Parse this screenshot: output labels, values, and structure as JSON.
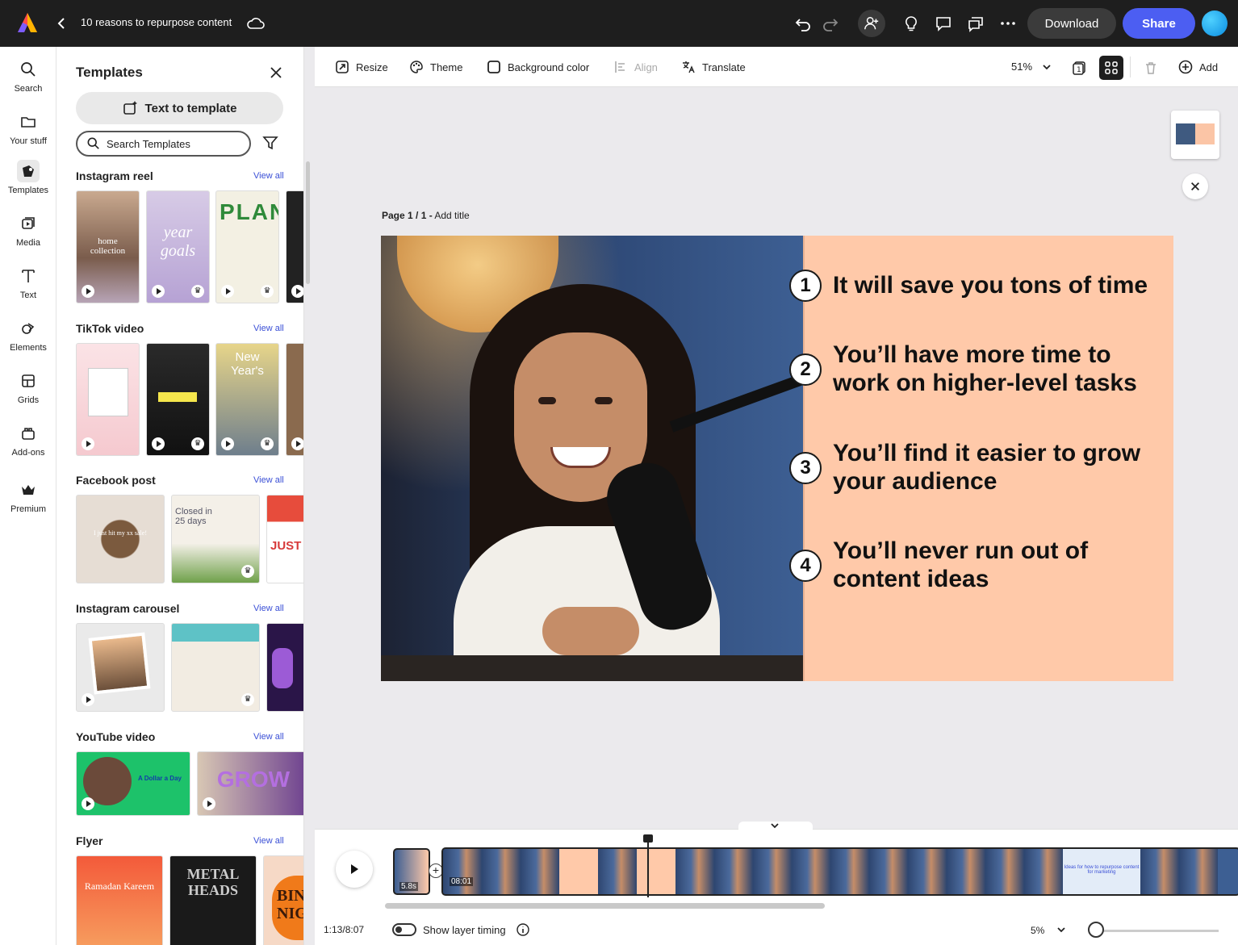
{
  "topbar": {
    "doc_title": "10 reasons to repurpose content",
    "download_label": "Download",
    "share_label": "Share"
  },
  "rail": {
    "items": [
      {
        "label": "Search",
        "icon": "search-icon"
      },
      {
        "label": "Your stuff",
        "icon": "folder-icon"
      },
      {
        "label": "Templates",
        "icon": "templates-icon"
      },
      {
        "label": "Media",
        "icon": "media-icon"
      },
      {
        "label": "Text",
        "icon": "text-icon"
      },
      {
        "label": "Elements",
        "icon": "elements-icon"
      },
      {
        "label": "Grids",
        "icon": "grids-icon"
      },
      {
        "label": "Add-ons",
        "icon": "addons-icon"
      },
      {
        "label": "Premium",
        "icon": "premium-crown-icon"
      }
    ]
  },
  "panel": {
    "title": "Templates",
    "text_to_template": "Text to template",
    "search_placeholder": "Search Templates",
    "view_all": "View all",
    "sections": [
      {
        "title": "Instagram reel"
      },
      {
        "title": "TikTok video"
      },
      {
        "title": "Facebook post"
      },
      {
        "title": "Instagram carousel"
      },
      {
        "title": "YouTube video"
      },
      {
        "title": "Flyer"
      }
    ],
    "thumb_text": {
      "reel1": "home collection",
      "reel2": "year goals",
      "reel3": "PLAN",
      "tiktok3": "New Year's",
      "fb1": "I just hit my xx sale!",
      "fb2": "Closed in 25 days",
      "fb3": "JUST",
      "yt1": "A Dollar a Day",
      "yt2": "GROW",
      "flyer1": "Ramadan Kareem",
      "flyer2": "METAL HEADS",
      "flyer3": "BIN NIG"
    }
  },
  "subbar": {
    "resize": "Resize",
    "theme": "Theme",
    "background_color": "Background color",
    "align": "Align",
    "translate": "Translate",
    "zoom": "51%",
    "add": "Add"
  },
  "canvas": {
    "page_label_bold": "Page 1 / 1 -",
    "page_label_rest": " Add title",
    "items": [
      {
        "num": "1",
        "text": "It will save you tons of time"
      },
      {
        "num": "2",
        "text": "You’ll have more time to work on higher-level tasks"
      },
      {
        "num": "3",
        "text": "You’ll find it easier to grow your audience"
      },
      {
        "num": "4",
        "text": "You’ll never run out of content ideas"
      }
    ],
    "colors": {
      "slide_bg": "#ffc9a9",
      "accent": "#4c5ef2"
    }
  },
  "timeline": {
    "clip1_duration": "5.8s",
    "clip2_duration": "08:01",
    "frame_caption": "Ideas for how to repurpose content for marketing",
    "current_time": "1:13/8:07",
    "show_layer_timing": "Show layer timing",
    "zoom": "5%"
  }
}
